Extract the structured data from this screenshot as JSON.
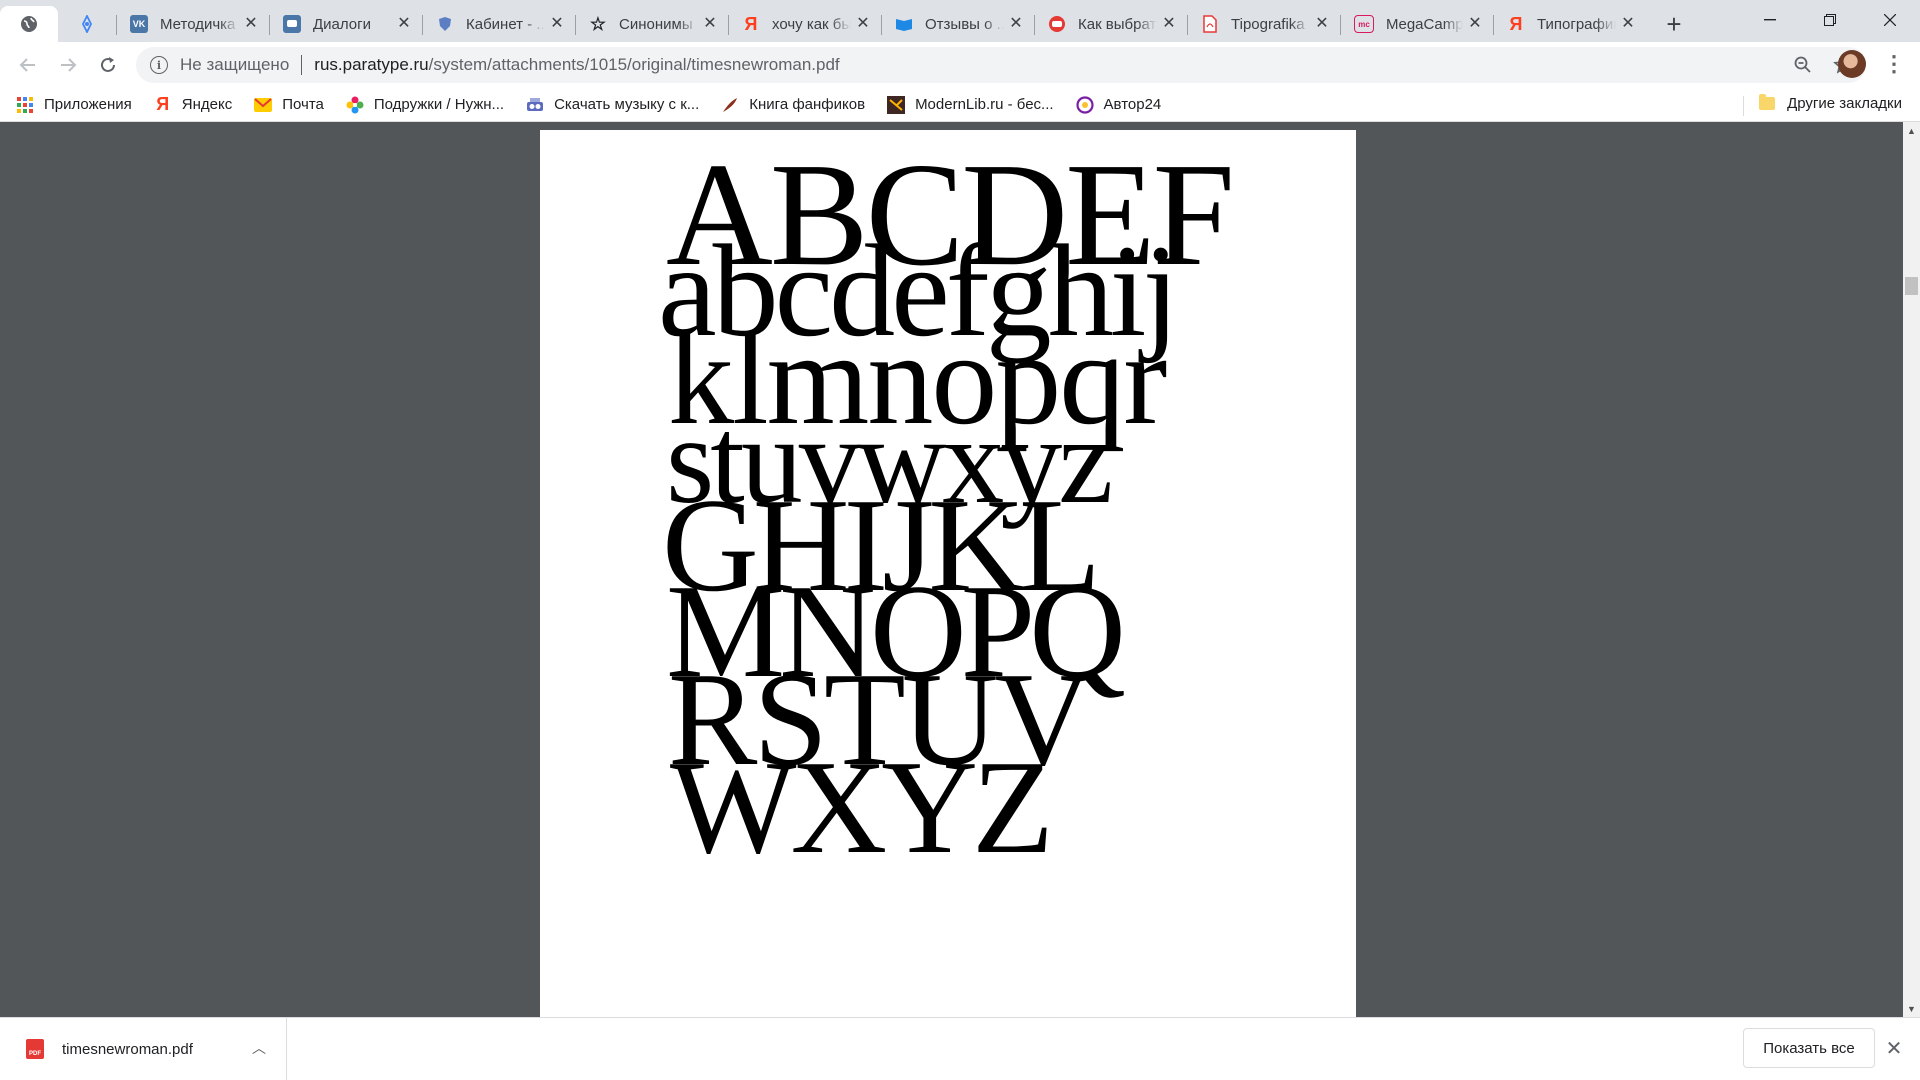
{
  "tabs": [
    {
      "title": "",
      "favicon": "globe-icon",
      "active": true
    },
    {
      "title": "",
      "favicon": "lens-icon",
      "pinned": true
    },
    {
      "title": "Методичка",
      "favicon": "vk-icon"
    },
    {
      "title": "Диалоги",
      "favicon": "chat-icon"
    },
    {
      "title": "Кабинет - ...",
      "favicon": "shield-icon"
    },
    {
      "title": "Синонимы",
      "favicon": "star-icon"
    },
    {
      "title": "хочу как бы",
      "favicon": "yandex-icon"
    },
    {
      "title": "Отзывы о ...",
      "favicon": "book-icon"
    },
    {
      "title": "Как выбрать",
      "favicon": "youtube-icon"
    },
    {
      "title": "Tipografika",
      "favicon": "pdf-icon"
    },
    {
      "title": "MegaCamp",
      "favicon": "mc-icon"
    },
    {
      "title": "Типографика",
      "favicon": "yandex-icon"
    }
  ],
  "new_tab_label": "+",
  "omnibox": {
    "security_text": "Не защищено",
    "host": "rus.paratype.ru",
    "path": "/system/attachments/1015/original/timesnewroman.pdf"
  },
  "bookmarks": [
    {
      "label": "Приложения",
      "icon": "apps-grid-icon"
    },
    {
      "label": "Яндекс",
      "icon": "yandex-icon"
    },
    {
      "label": "Почта",
      "icon": "mail-icon"
    },
    {
      "label": "Подружки / Нужн...",
      "icon": "flower-icon"
    },
    {
      "label": "Скачать музыку с к...",
      "icon": "music-icon"
    },
    {
      "label": "Книга фанфиков",
      "icon": "feather-icon"
    },
    {
      "label": "ModernLib.ru - бес...",
      "icon": "book-icon"
    },
    {
      "label": "Автор24",
      "icon": "author24-icon"
    }
  ],
  "other_bookmarks": "Другие закладки",
  "pdf_lines": [
    "ABCDEF",
    "abcdefghij",
    "klmnopqr",
    "stuvwxyz",
    "GHIJKL",
    "MNOPQ",
    "RSTUV",
    "WXYZ"
  ],
  "download": {
    "filename": "timesnewroman.pdf",
    "show_all_label": "Показать все"
  }
}
